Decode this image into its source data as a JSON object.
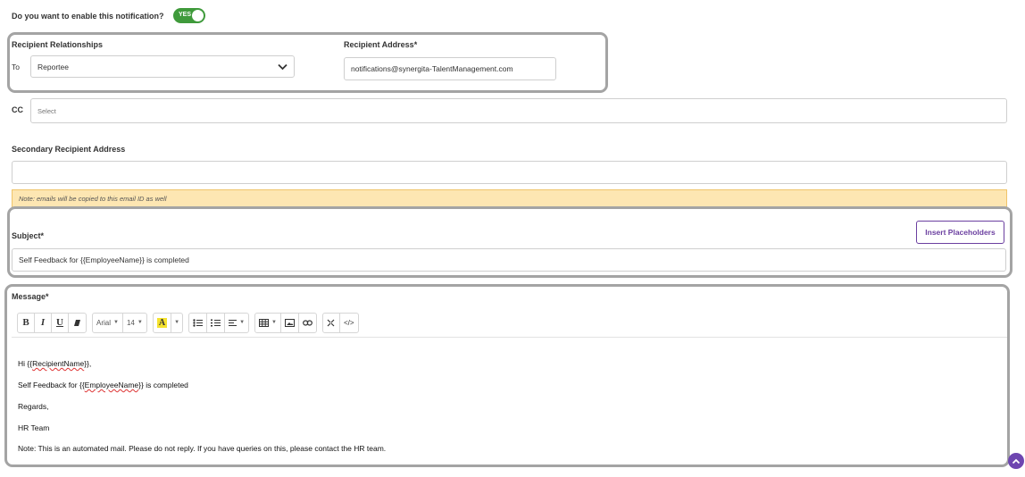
{
  "enable": {
    "question": "Do you want to enable this notification?",
    "toggle_label": "YES"
  },
  "recipient": {
    "relationships_label": "Recipient Relationships",
    "to_label": "To",
    "to_value": "Reportee",
    "address_label": "Recipient Address*",
    "address_value": "notifications@synergita-TalentManagement.com"
  },
  "cc": {
    "label": "CC",
    "placeholder": "Select"
  },
  "secondary": {
    "label": "Secondary Recipient Address",
    "value": ""
  },
  "note": "Note: emails will be copied to this email ID as well",
  "subject": {
    "label": "Subject*",
    "button": "Insert Placeholders",
    "value": "Self Feedback for {{EmployeeName}} is completed"
  },
  "message": {
    "label": "Message*",
    "toolbar": {
      "font": "Arial",
      "size": "14",
      "highlight": "A",
      "code": "</>"
    },
    "body": {
      "greeting_prefix": "Hi {{",
      "greeting_var": "RecipientName",
      "greeting_suffix": "}},",
      "line1_prefix": "Self Feedback for {{",
      "line1_var": "EmployeeName",
      "line1_suffix": "}} is completed",
      "regards": "Regards,",
      "team": "HR Team",
      "note": "Note: This is an automated mail. Please do not reply. If you have queries on this, please contact the HR team."
    }
  },
  "colors": {
    "toggle": "#3f9a3b",
    "accent": "#6b3fa0",
    "note_bg": "#fde6b2",
    "scroll_button": "#6e46b0"
  }
}
